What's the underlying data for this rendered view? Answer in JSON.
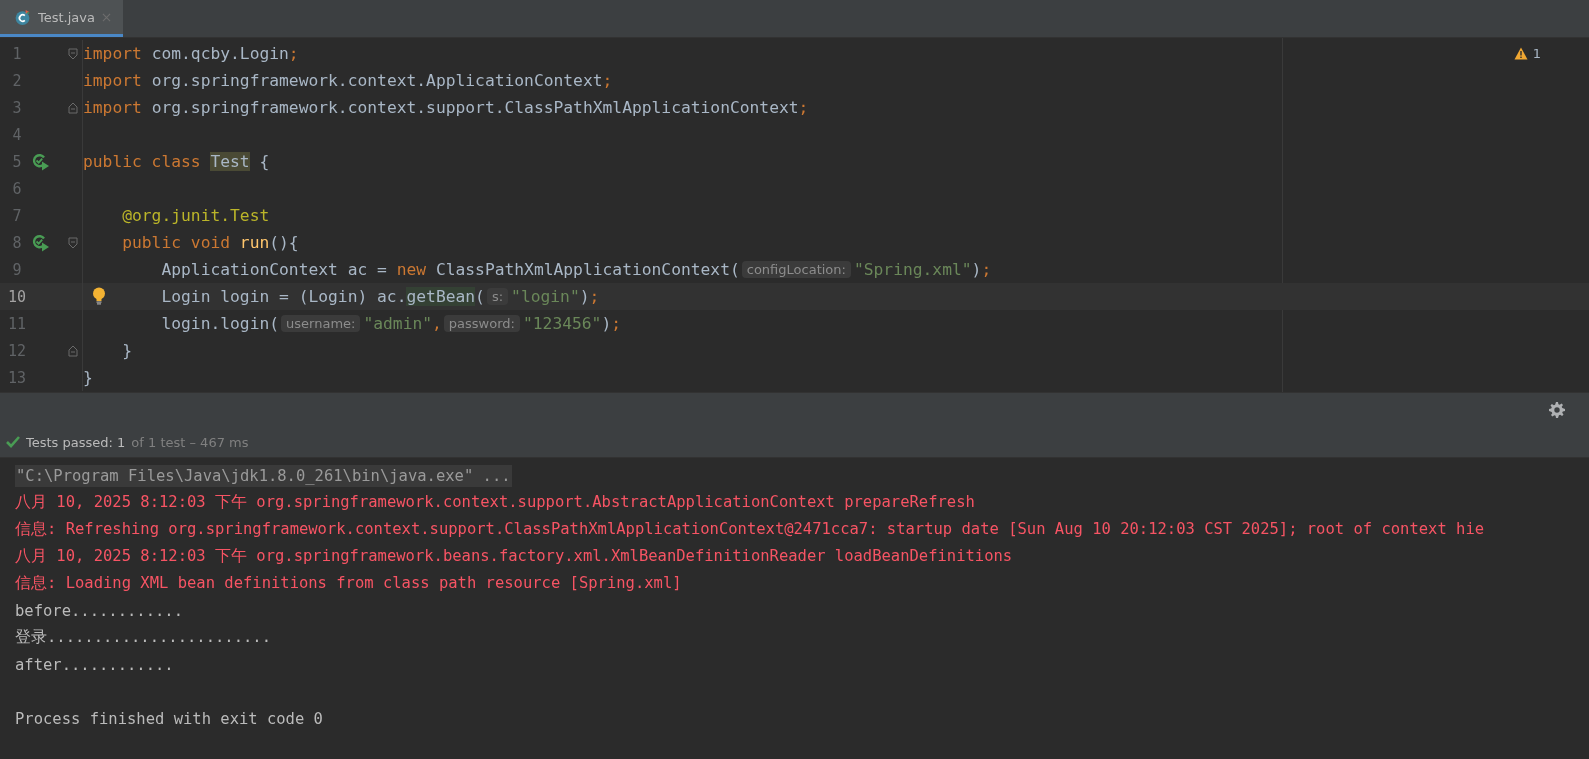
{
  "tabs": [
    {
      "label": "Test.java",
      "selected": true
    }
  ],
  "warnings": {
    "count": "1"
  },
  "code_lines": [
    {
      "number": "1",
      "fold_start": true,
      "tokens": [
        {
          "kind": "kw",
          "text": "import "
        },
        {
          "kind": "plain",
          "text": "com.qcby.Login"
        },
        {
          "kind": "kw",
          "text": ";"
        }
      ]
    },
    {
      "number": "2",
      "tokens": [
        {
          "kind": "kw",
          "text": "import "
        },
        {
          "kind": "plain",
          "text": "org.springframework.context.ApplicationContext"
        },
        {
          "kind": "kw",
          "text": ";"
        }
      ]
    },
    {
      "number": "3",
      "fold_end": true,
      "tokens": [
        {
          "kind": "kw",
          "text": "import "
        },
        {
          "kind": "plain",
          "text": "org.springframework.context.support.ClassPathXmlApplicationContext"
        },
        {
          "kind": "kw",
          "text": ";"
        }
      ]
    },
    {
      "number": "4"
    },
    {
      "number": "5",
      "run_icon": true,
      "tokens": [
        {
          "kind": "kw",
          "text": "public class "
        },
        {
          "kind": "mark",
          "text": "Test"
        },
        {
          "kind": "plain",
          "text": " {"
        }
      ]
    },
    {
      "number": "6"
    },
    {
      "number": "7",
      "tokens": [
        {
          "kind": "ann",
          "text": "    @org.junit.Test"
        }
      ]
    },
    {
      "number": "8",
      "run_icon": true,
      "fold_start": true,
      "tokens": [
        {
          "kind": "kw",
          "text": "    public void "
        },
        {
          "kind": "decl",
          "text": "run"
        },
        {
          "kind": "plain",
          "text": "(){"
        }
      ]
    },
    {
      "number": "9",
      "tokens": [
        {
          "kind": "plain",
          "text": "        ApplicationContext ac = "
        },
        {
          "kind": "kw",
          "text": "new "
        },
        {
          "kind": "plain",
          "text": "ClassPathXmlApplicationContext("
        },
        {
          "kind": "hint",
          "text": "configLocation:"
        },
        {
          "kind": "str",
          "text": "\"Spring.xml\""
        },
        {
          "kind": "plain",
          "text": ")"
        },
        {
          "kind": "kw",
          "text": ";"
        }
      ]
    },
    {
      "number": "10",
      "current": true,
      "bulb": true,
      "tokens": [
        {
          "kind": "plain",
          "text": "        Login login = (Login) ac."
        },
        {
          "kind": "usage",
          "text": "getBean"
        },
        {
          "kind": "plain",
          "text": "("
        },
        {
          "kind": "hint",
          "text": "s:"
        },
        {
          "kind": "str",
          "text": "\"login\""
        },
        {
          "kind": "plain",
          "text": ")"
        },
        {
          "kind": "kw",
          "text": ";"
        }
      ]
    },
    {
      "number": "11",
      "tokens": [
        {
          "kind": "plain",
          "text": "        login.login("
        },
        {
          "kind": "hint",
          "text": "username:"
        },
        {
          "kind": "str",
          "text": "\"admin\""
        },
        {
          "kind": "kw",
          "text": ","
        },
        {
          "kind": "hint",
          "text": "password:"
        },
        {
          "kind": "str",
          "text": "\"123456\""
        },
        {
          "kind": "plain",
          "text": ")"
        },
        {
          "kind": "kw",
          "text": ";"
        }
      ]
    },
    {
      "number": "12",
      "fold_end": true,
      "tokens": [
        {
          "kind": "plain",
          "text": "    }"
        }
      ]
    },
    {
      "number": "13",
      "tokens": [
        {
          "kind": "plain",
          "text": "}"
        }
      ]
    }
  ],
  "test_status": {
    "passed": true,
    "summary": "Tests passed: 1",
    "detail": "of 1 test – 467 ms"
  },
  "console": [
    {
      "kind": "command",
      "text": "\"C:\\Program Files\\Java\\jdk1.8.0_261\\bin\\java.exe\" ..."
    },
    {
      "kind": "error",
      "text": "八月 10, 2025 8:12:03 下午 org.springframework.context.support.AbstractApplicationContext prepareRefresh"
    },
    {
      "kind": "error",
      "text": "信息: Refreshing org.springframework.context.support.ClassPathXmlApplicationContext@2471cca7: startup date [Sun Aug 10 20:12:03 CST 2025]; root of context hie"
    },
    {
      "kind": "error",
      "text": "八月 10, 2025 8:12:03 下午 org.springframework.beans.factory.xml.XmlBeanDefinitionReader loadBeanDefinitions"
    },
    {
      "kind": "error",
      "text": "信息: Loading XML bean definitions from class path resource [Spring.xml]"
    },
    {
      "kind": "output",
      "text": "before............"
    },
    {
      "kind": "output",
      "text": "登录........................"
    },
    {
      "kind": "output",
      "text": "after............"
    },
    {
      "kind": "blank"
    },
    {
      "kind": "output",
      "text": "Process finished with exit code 0"
    }
  ]
}
